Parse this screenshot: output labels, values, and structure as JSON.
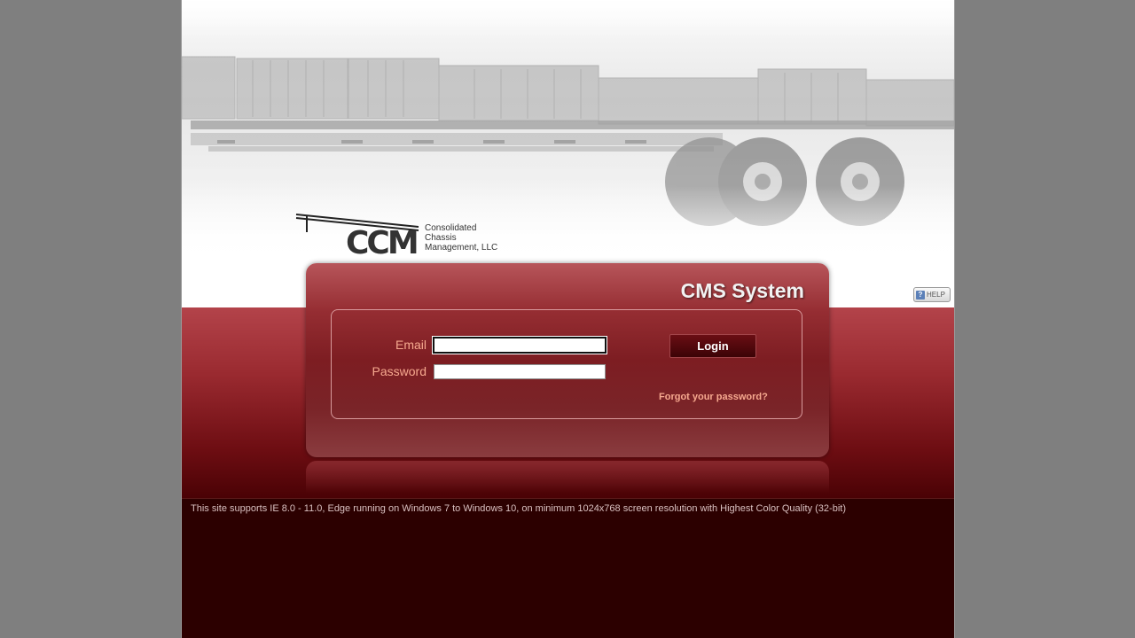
{
  "brand": {
    "logo_letters": "CCM",
    "company_lines": [
      "Consolidated",
      "Chassis",
      "Management, LLC"
    ]
  },
  "panel": {
    "title": "CMS System",
    "email_label": "Email",
    "email_value": "",
    "password_label": "Password",
    "password_value": "",
    "login_label": "Login",
    "forgot_label": "Forgot your password?"
  },
  "help": {
    "label": "HELP",
    "icon": "question-icon"
  },
  "footer": {
    "notice": "This site supports IE 8.0 - 11.0, Edge running on Windows 7 to Windows 10, on minimum 1024x768 screen resolution with Highest Color Quality (32-bit)"
  },
  "colors": {
    "accent": "#9a2a30",
    "label": "#f6a98f",
    "footer_bg": "#2c0000",
    "page_bg": "#7f7f7f"
  }
}
